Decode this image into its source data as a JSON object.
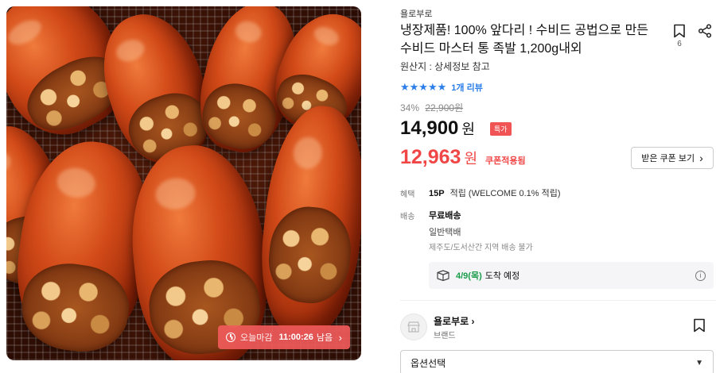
{
  "product_image": {
    "timer": {
      "label": "오늘마감",
      "value": "11:00:26",
      "suffix": "남음",
      "arrow": "›"
    }
  },
  "product": {
    "brand": "욜로부로",
    "title": "냉장제품! 100% 앞다리 ! 수비드 공법으로 만든 수비드 마스터 통 족발 1,200g내외",
    "bookmark_count": "6",
    "origin": "원산지 : 상세정보 참고",
    "rating_stars": "★★★★★",
    "review_text": "1개 리뷰",
    "discount_rate": "34%",
    "original_price": "22,900원",
    "price": "14,900",
    "price_unit": "원",
    "special_badge": "특가",
    "coupon_price": "12,963",
    "coupon_price_unit": "원",
    "coupon_applied_label": "쿠폰적용됨",
    "coupon_button_label": "받은 쿠폰 보기",
    "coupon_button_arrow": "›"
  },
  "benefits": {
    "label": "혜택",
    "points": "15P",
    "points_text": "적립 (WELCOME 0.1% 적립)"
  },
  "shipping": {
    "label": "배송",
    "type": "무료배송",
    "method": "일반택배",
    "note": "제주도/도서산간 지역 배송 불가",
    "delivery_date": "4/9(목)",
    "delivery_suffix": "도착 예정",
    "info_icon": "i"
  },
  "brand_section": {
    "name": "욜로부로",
    "name_arrow": "›",
    "sub": "브랜드"
  },
  "option": {
    "label": "옵션선택",
    "chevron": "▼"
  },
  "icons": {
    "bookmark": "bookmark-icon",
    "share": "share-icon",
    "clock": "clock-icon",
    "delivery_box": "box-icon",
    "info": "info-icon"
  },
  "colors": {
    "accent_red": "#f04646",
    "star_blue": "#2b7de9",
    "delivery_green": "#1a9c4a",
    "timer_bg": "#f05a5a"
  }
}
